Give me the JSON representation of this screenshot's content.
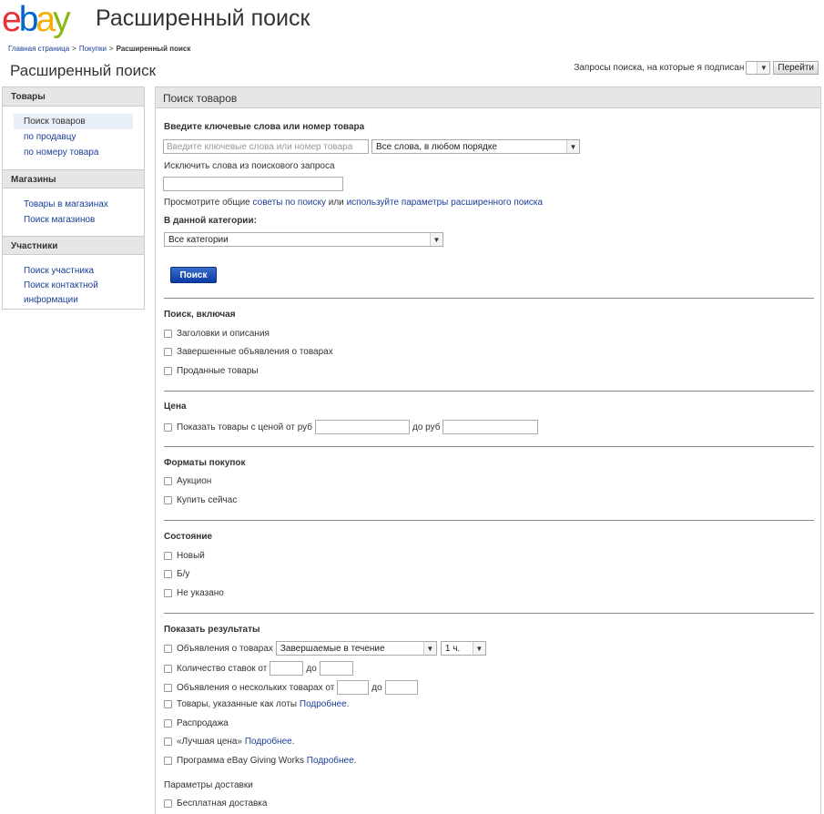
{
  "header": {
    "logo_text": "ebay",
    "title": "Расширенный поиск"
  },
  "breadcrumb": {
    "items": [
      "Главная страница",
      "Покупки"
    ],
    "separator": ">",
    "current": "Расширенный поиск"
  },
  "page_title": "Расширенный поиск",
  "subscriptions": {
    "label": "Запросы поиска, на которые я подписан",
    "go_label": "Перейти"
  },
  "sidebar": {
    "sections": [
      {
        "title": "Товары",
        "items": [
          "Поиск товаров",
          "по продавцу",
          "по номеру товара"
        ]
      },
      {
        "title": "Магазины",
        "items": [
          "Товары в магазинах",
          "Поиск магазинов"
        ]
      },
      {
        "title": "Участники",
        "items": [
          "Поиск участника",
          "Поиск контактной информации"
        ]
      }
    ]
  },
  "main": {
    "title": "Поиск товаров",
    "keywords_label": "Введите ключевые слова или номер товара",
    "keywords_placeholder": "Введите ключевые слова или номер товара",
    "keywords_mode": "Все слова, в любом порядке",
    "exclude_label": "Исключить слова из поискового запроса",
    "tips_prefix": "Просмотрите общие",
    "tips_link": "советы по поиску",
    "tips_or": "или",
    "tips_link2": "используйте параметры расширенного поиска",
    "category_label": "В данной категории:",
    "category_value": "Все категории",
    "search_button": "Поиск",
    "include": {
      "title": "Поиск, включая",
      "options": [
        "Заголовки и описания",
        "Завершенные объявления о товарах",
        "Проданные товары"
      ]
    },
    "price": {
      "title": "Цена",
      "from_label": "Показать товары с ценой от руб",
      "to_label": "до руб"
    },
    "formats": {
      "title": "Форматы покупок",
      "options": [
        "Аукцион",
        "Купить сейчас"
      ]
    },
    "condition": {
      "title": "Состояние",
      "options": [
        "Новый",
        "Б/у",
        "Не указано"
      ]
    },
    "results": {
      "title": "Показать результаты",
      "listings_label": "Объявления о товарах",
      "listings_select": "Завершаемые в течение",
      "hours_select": "1 ч.",
      "bids_label": "Количество ставок от",
      "bids_to": "до",
      "multi_label": "Объявления о нескольких товарах от",
      "multi_to": "до",
      "lots_label": "Товары, указанные как лоты",
      "more_link": "Подробнее.",
      "sale_label": "Распродажа",
      "best_price_label": "«Лучшая цена»",
      "giving_label": "Программа eBay Giving Works"
    },
    "shipping": {
      "title": "Параметры доставки",
      "free_label": "Бесплатная доставка"
    }
  }
}
